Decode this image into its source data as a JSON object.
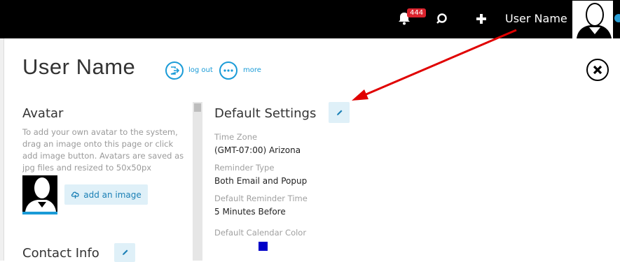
{
  "topbar": {
    "notification_count": "444",
    "user_name": "User Name"
  },
  "header": {
    "title": "User Name",
    "logout_label": "log out",
    "more_label": "more"
  },
  "avatar_section": {
    "title": "Avatar",
    "description": "To add your own avatar to the system, drag an image onto this page or click add image button. Avatars are saved as jpg files and resized to 50x50px",
    "add_image_label": "add an image"
  },
  "contact_section": {
    "title": "Contact Info"
  },
  "default_settings": {
    "title": "Default Settings",
    "fields": [
      {
        "label": "Time Zone",
        "value": "(GMT-07:00) Arizona"
      },
      {
        "label": "Reminder Type",
        "value": "Both Email and Popup"
      },
      {
        "label": "Default Reminder Time",
        "value": "5 Minutes Before"
      },
      {
        "label": "Default Calendar Color",
        "value": ""
      }
    ],
    "calendar_color": "#0000c8"
  },
  "colors": {
    "accent": "#1a9bd7",
    "badge": "#d9232d",
    "annotation_arrow": "#e00000"
  }
}
